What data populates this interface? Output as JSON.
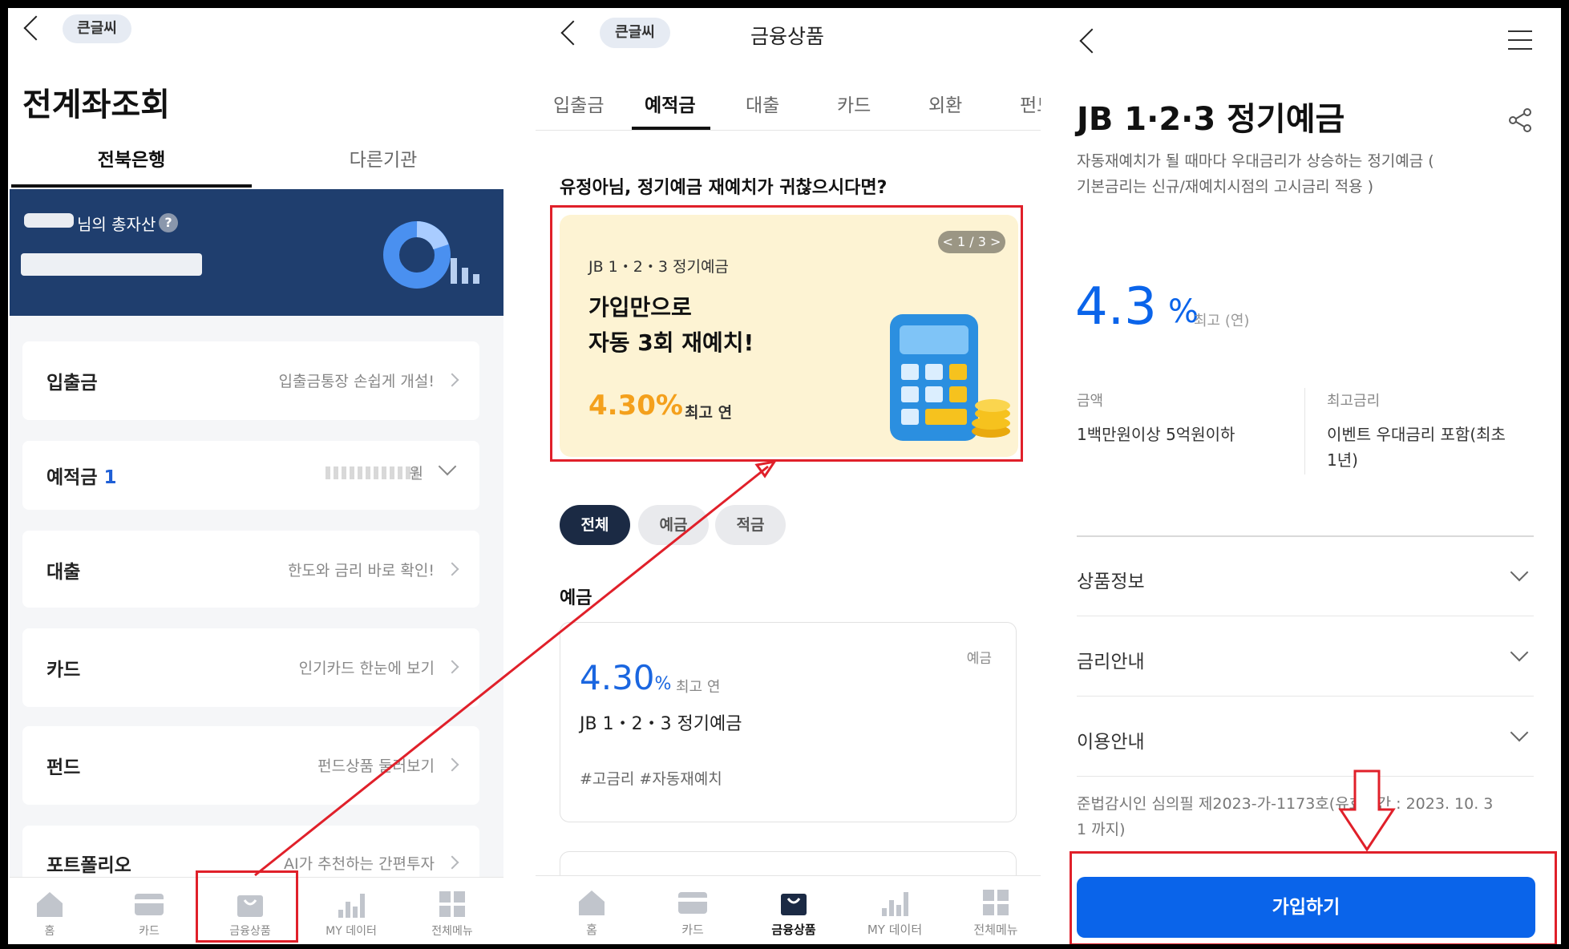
{
  "colors": {
    "brand_blue": "#0a64ea",
    "navy": "#1f3e6e",
    "orange": "#f4a01c",
    "promo_bg": "#fdf3d3",
    "annotation_red": "#e0202a"
  },
  "screen1": {
    "font_size_badge": "큰글씨",
    "title": "전계좌조회",
    "tabs": [
      "전북은행",
      "다른기관"
    ],
    "assets": {
      "label": "님의 총자산",
      "help": "?"
    },
    "menu": [
      {
        "label": "입출금",
        "sub": "입출금통장 손쉽게 개설!"
      },
      {
        "label": "예적금",
        "count": "1",
        "sub": "원"
      },
      {
        "label": "대출",
        "sub": "한도와 금리 바로 확인!"
      },
      {
        "label": "카드",
        "sub": "인기카드 한눈에 보기"
      },
      {
        "label": "펀드",
        "sub": "펀드상품 둘러보기"
      },
      {
        "label": "포트폴리오",
        "sub": "AI가 추천하는 간편투자"
      }
    ],
    "nav": [
      "홈",
      "카드",
      "금융상품",
      "MY 데이터",
      "전체메뉴"
    ]
  },
  "screen2": {
    "font_size_badge": "큰글씨",
    "title": "금융상품",
    "tabs": [
      "입출금",
      "예적금",
      "대출",
      "카드",
      "외환",
      "펀드"
    ],
    "headline": "유정아님, 정기예금 재예치가 귀찮으시다면?",
    "promo": {
      "pager": "< 1 / 3 >",
      "product": "JB 1・2・3 정기예금",
      "line1": "가입만으로",
      "line2": "자동 3회 재예치!",
      "rate": "4.30%",
      "rate_note": "최고 연"
    },
    "filters": [
      "전체",
      "예금",
      "적금"
    ],
    "section": "예금",
    "card": {
      "type": "예금",
      "rate": "4.30",
      "unit": "%",
      "rate_note": "최고 연",
      "name": "JB 1・2・3 정기예금",
      "tags": "#고금리 #자동재예치"
    },
    "nav": [
      "홈",
      "카드",
      "금융상품",
      "MY 데이터",
      "전체메뉴"
    ]
  },
  "screen3": {
    "title": "JB 1·2·3 정기예금",
    "desc_line1": "자동재예치가 될 때마다 우대금리가 상승하는 정기예금 (",
    "desc_line2": "기본금리는 신규/재예치시점의 고시금리 적용 )",
    "rate": "4.3",
    "unit": "%",
    "rate_note": "최고 (연)",
    "amount_label": "금액",
    "amount_value": "1백만원이상 5억원이하",
    "max_label": "최고금리",
    "max_value_line1": "이벤트 우대금리 포함(최초",
    "max_value_line2": "1년)",
    "accordions": [
      "상품정보",
      "금리안내",
      "이용안내"
    ],
    "notice_line1": "준법감시인 심의필 제2023-가-1173호(유효기간 : 2023. 10. 3",
    "notice_line2": "1 까지)",
    "cta": "가입하기"
  }
}
